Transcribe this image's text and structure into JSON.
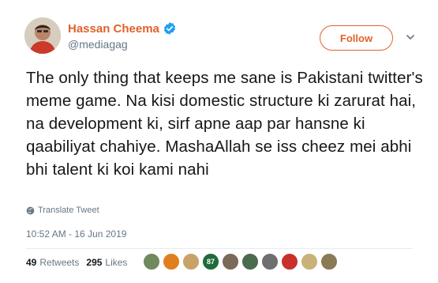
{
  "author": {
    "display_name": "Hassan Cheema",
    "handle": "@mediagag",
    "verified_icon": "verified-badge-icon",
    "avatar_icon": "avatar"
  },
  "actions": {
    "follow_label": "Follow",
    "menu_icon": "chevron-down-icon"
  },
  "tweet": {
    "text": "The only thing that keeps me sane is Pakistani twitter's meme game. Na kisi domestic structure ki zarurat hai, na development ki, sirf apne aap par hansne ki qaabiliyat chahiye. MashaAllah se iss cheez mei abhi bhi talent ki koi kami nahi",
    "translate_label": "Translate Tweet",
    "timestamp": "10:52 AM - 16 Jun 2019"
  },
  "stats": {
    "retweets_count": "49",
    "retweets_label": "Retweets",
    "likes_count": "295",
    "likes_label": "Likes"
  },
  "liker_avatars": [
    {
      "color": "#6e8a5e"
    },
    {
      "color": "#e07f1f"
    },
    {
      "color": "#c9a26a"
    },
    {
      "color": "#1f6b3a",
      "label": "87"
    },
    {
      "color": "#7b6a58"
    },
    {
      "color": "#4b6b4e"
    },
    {
      "color": "#6f6f6f"
    },
    {
      "color": "#c8302c"
    },
    {
      "color": "#c9b27a"
    },
    {
      "color": "#8a7a55"
    }
  ],
  "colors": {
    "accent": "#e0622a",
    "verified": "#1da1f2",
    "muted": "#657786",
    "text": "#14171a"
  }
}
